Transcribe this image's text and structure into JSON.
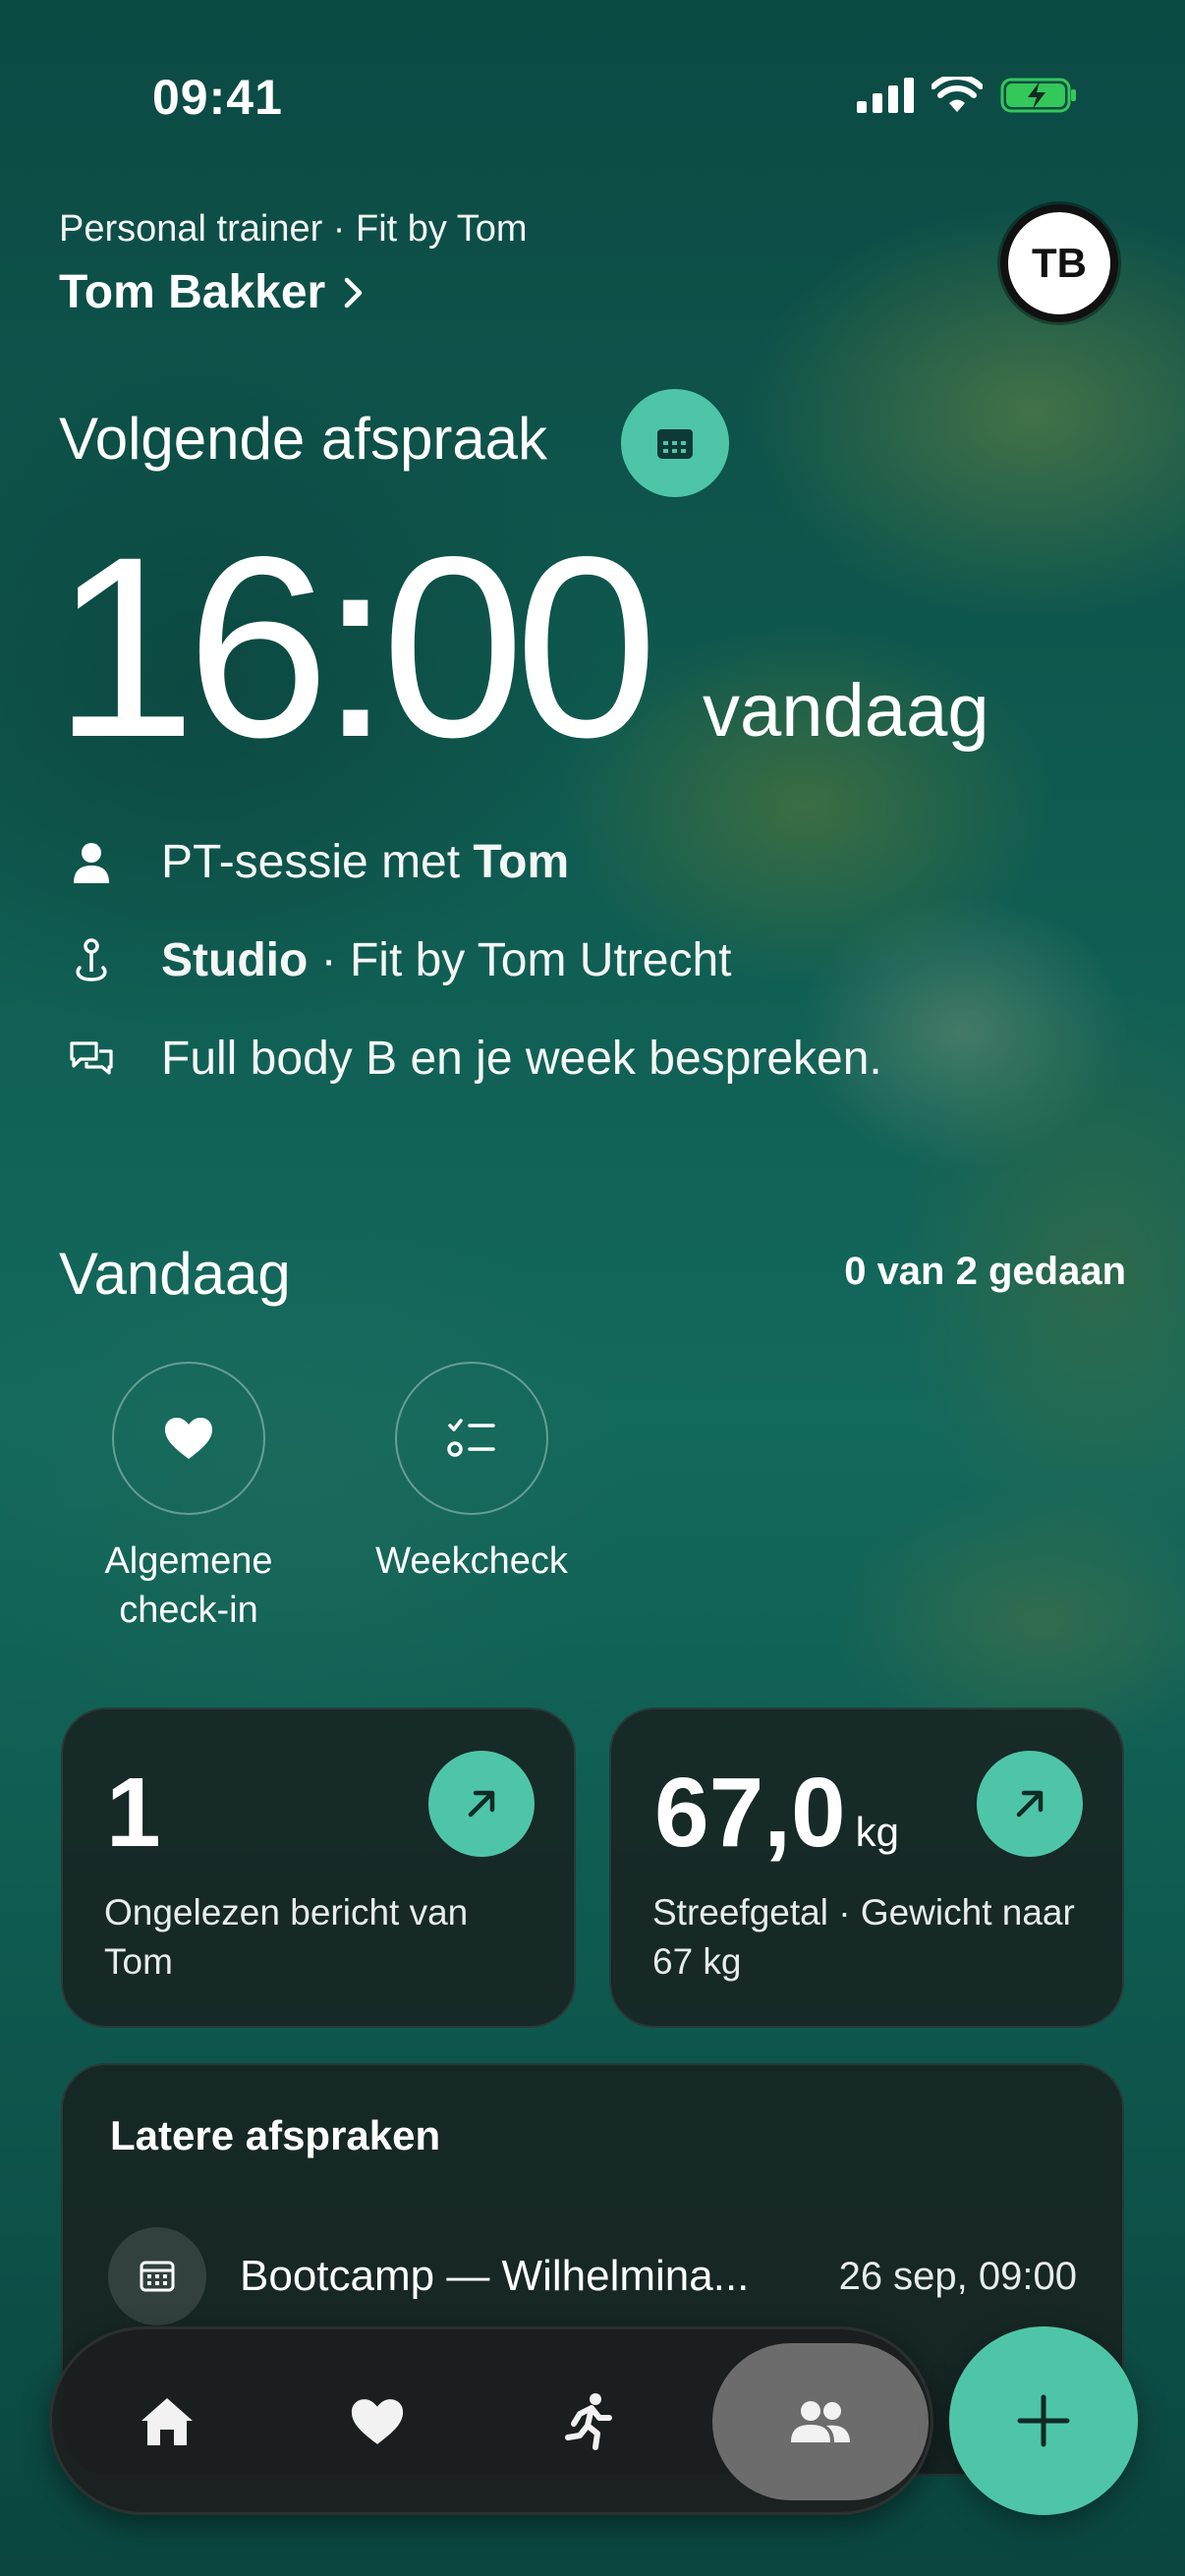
{
  "status_bar": {
    "time": "09:41",
    "icons": [
      "signal-icon",
      "wifi-icon",
      "battery-charging-icon"
    ]
  },
  "header": {
    "subtitle": "Personal trainer · Fit by Tom",
    "trainer_name": "Tom Bakker",
    "avatar_initials": "TB"
  },
  "next_appointment": {
    "title": "Volgende afspraak",
    "time": "16:00",
    "day": "vandaag",
    "details": {
      "session_prefix": "PT-sessie met ",
      "session_trainer": "Tom",
      "location_name": "Studio",
      "location_rest": " · Fit by Tom Utrecht",
      "note": "Full body B en je week bespreken."
    }
  },
  "today": {
    "title": "Vandaag",
    "progress_text": "0 van 2 gedaan",
    "tasks": [
      {
        "label": "Algemene\ncheck-in",
        "icon": "heart-icon"
      },
      {
        "label": "Weekcheck",
        "icon": "checklist-icon"
      }
    ]
  },
  "cards": {
    "messages": {
      "value": "1",
      "description": "Ongelezen bericht van Tom"
    },
    "weight": {
      "value": "67,0",
      "unit": "kg",
      "description": "Streefgetal · Gewicht naar 67 kg"
    }
  },
  "later": {
    "title": "Latere afspraken",
    "items": [
      {
        "name": "Bootcamp — Wilhelmina...",
        "date": "26 sep, 09:00"
      }
    ]
  },
  "tabbar": {
    "tabs": [
      "home-icon",
      "heart-icon",
      "running-icon",
      "people-icon"
    ],
    "active_tab": "people-icon"
  },
  "colors": {
    "accent": "#4fc5a8",
    "card_bg": "#181e1e"
  }
}
